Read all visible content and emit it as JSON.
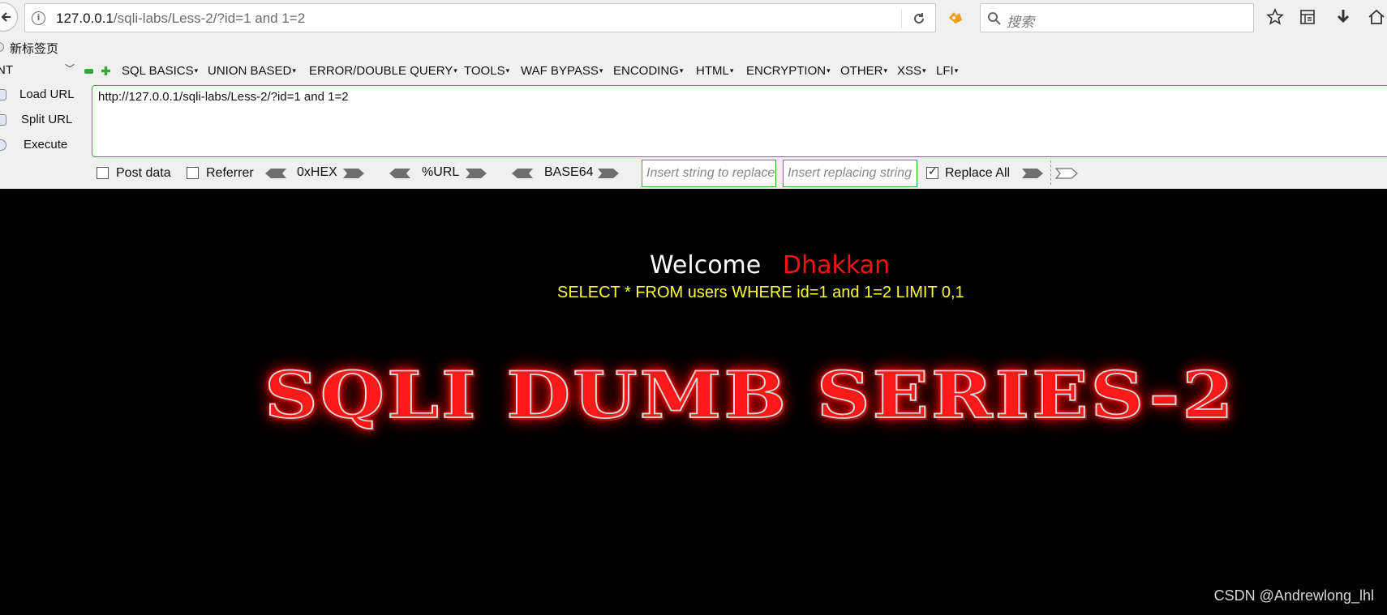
{
  "browser": {
    "url_host": "127.0.0.1",
    "url_path": "/sqli-labs/Less-2/?id=1 and 1=2",
    "search_placeholder": "搜索",
    "bookmark_label": "新标签页"
  },
  "hackbar": {
    "combo_value": "NT",
    "menu": [
      "SQL BASICS",
      "UNION BASED",
      "ERROR/DOUBLE QUERY",
      "TOOLS",
      "WAF BYPASS",
      "ENCODING",
      "HTML",
      "ENCRYPTION",
      "OTHER",
      "XSS",
      "LFI"
    ],
    "load_url": "Load URL",
    "split_url": "Split URL",
    "execute": "Execute",
    "url_text": "http://127.0.0.1/sqli-labs/Less-2/?id=1 and 1=2",
    "post_data": "Post data",
    "referrer": "Referrer",
    "hex": "0xHEX",
    "url_enc": "%URL",
    "base64": "BASE64",
    "replace_placeholder": "Insert string to replace",
    "replacing_placeholder": "Insert replacing string",
    "replace_all": "Replace All",
    "replace_all_checked": true
  },
  "page": {
    "welcome": "Welcome",
    "name": "Dhakkan",
    "query": "SELECT * FROM users WHERE id=1 and 1=2 LIMIT 0,1",
    "banner": "SQLI DUMB SERIES-2",
    "watermark": "CSDN @Andrewlong_lhl"
  },
  "colors": {
    "accent_green": "#3aa53a",
    "query_yellow": "#ffff33",
    "name_red": "#f21414"
  }
}
